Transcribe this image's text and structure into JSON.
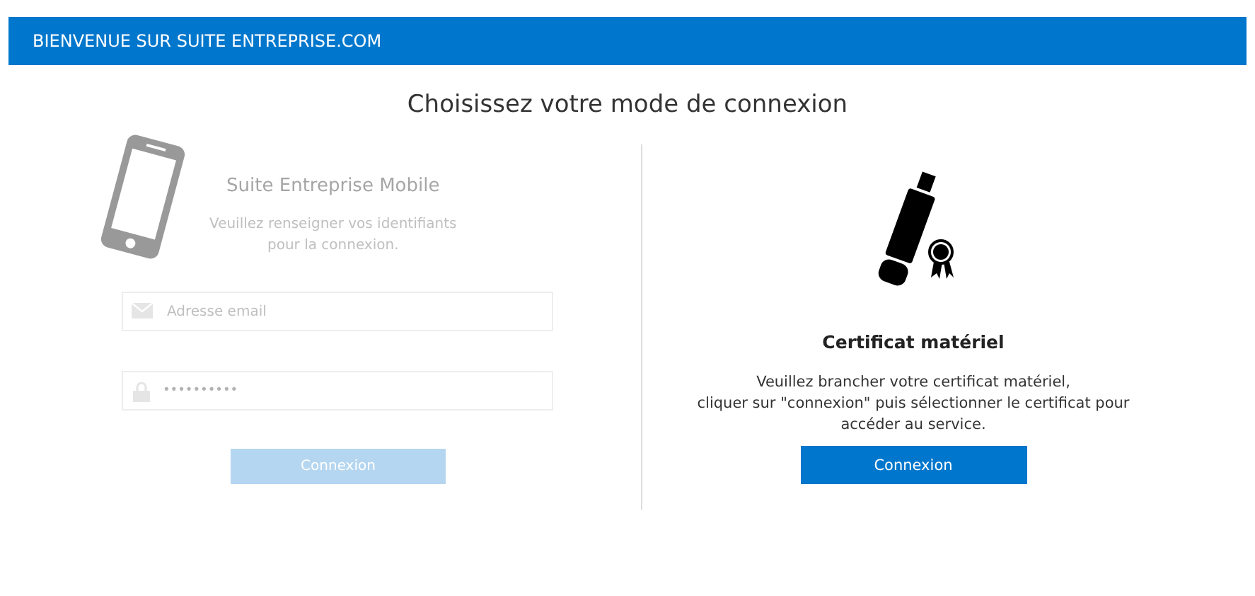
{
  "header": {
    "title": "BIENVENUE SUR SUITE ENTREPRISE.COM"
  },
  "heading": "Choisissez votre mode de connexion",
  "mobile": {
    "disabled": true,
    "title": "Suite Entreprise Mobile",
    "description": [
      "Veuillez renseigner vos identifiants",
      "pour la connexion."
    ],
    "email": {
      "placeholder": "Adresse email"
    },
    "password": {
      "value": "••••••••••"
    },
    "button": "Connexion"
  },
  "certificate": {
    "title": "Certificat matériel",
    "description": [
      "Veuillez brancher votre certificat matériel,",
      "cliquer sur \"connexion\" puis sélectionner le certificat pour",
      "accéder au service."
    ],
    "button": "Connexion"
  }
}
